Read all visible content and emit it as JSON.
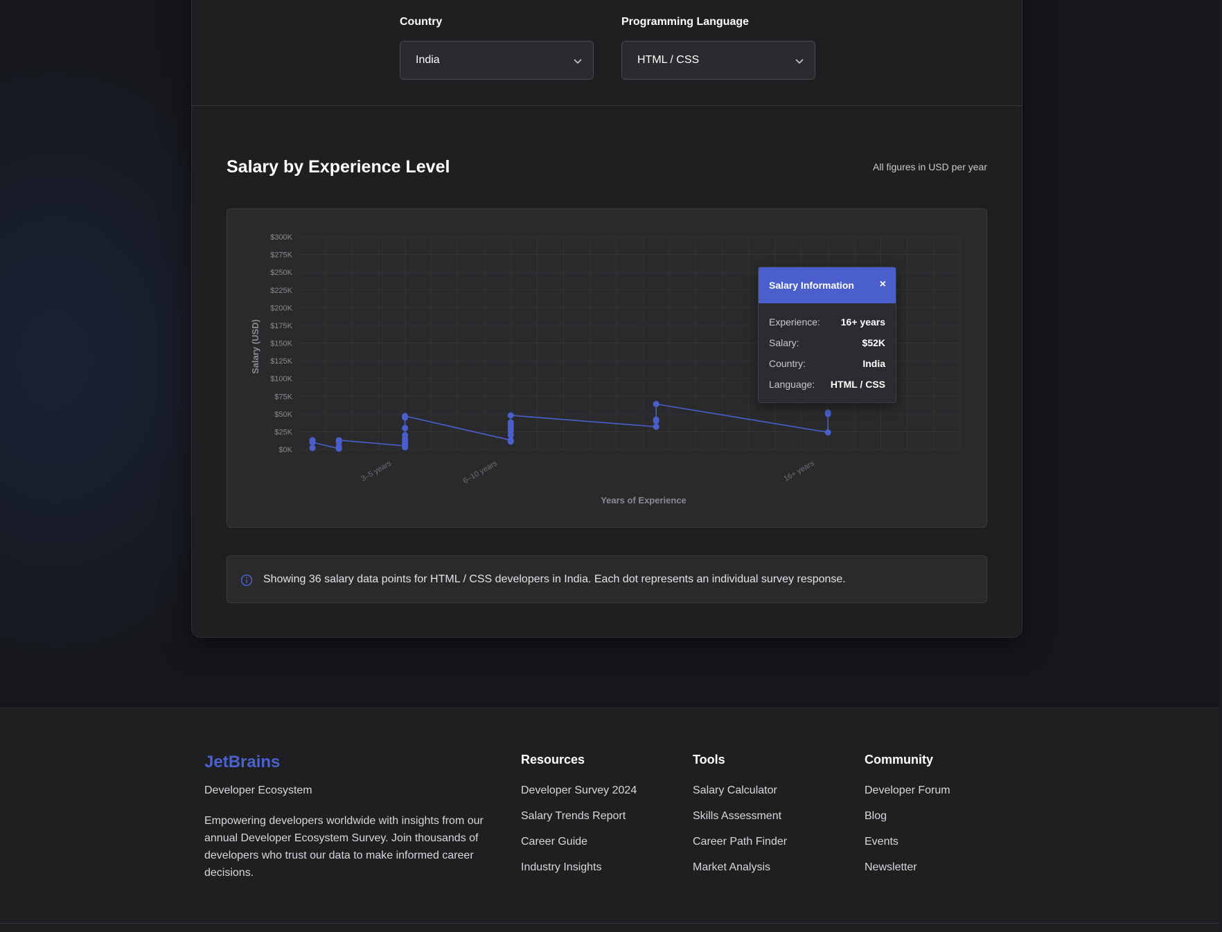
{
  "filters": {
    "country": {
      "label": "Country",
      "value": "India"
    },
    "language": {
      "label": "Programming Language",
      "value": "HTML / CSS"
    }
  },
  "section": {
    "title": "Salary by Experience Level",
    "note": "All figures in USD per year"
  },
  "chart_data": {
    "type": "scatter",
    "xlabel": "Years of Experience",
    "ylabel": "Salary (USD)",
    "x_categories_slots": 25,
    "x_tick_labels": [
      {
        "slot": 3.5,
        "label": "3–5 years"
      },
      {
        "slot": 7.5,
        "label": "6–10 years"
      },
      {
        "slot": 19.5,
        "label": "16+ years"
      }
    ],
    "y_ticks": [
      "$0K",
      "$25K",
      "$50K",
      "$75K",
      "$100K",
      "$125K",
      "$150K",
      "$175K",
      "$200K",
      "$225K",
      "$250K",
      "$275K",
      "$300K"
    ],
    "ylim": [
      0,
      300
    ],
    "grid": true,
    "accent": "#4a5fcc",
    "points": [
      {
        "slot": 0.5,
        "salary_k": 13
      },
      {
        "slot": 0.5,
        "salary_k": 10
      },
      {
        "slot": 0.5,
        "salary_k": 2
      },
      {
        "slot": 1.5,
        "salary_k": 13
      },
      {
        "slot": 1.5,
        "salary_k": 10
      },
      {
        "slot": 1.5,
        "salary_k": 4
      },
      {
        "slot": 1.5,
        "salary_k": 1
      },
      {
        "slot": 4.0,
        "salary_k": 47
      },
      {
        "slot": 4.0,
        "salary_k": 45
      },
      {
        "slot": 4.0,
        "salary_k": 30
      },
      {
        "slot": 4.0,
        "salary_k": 20
      },
      {
        "slot": 4.0,
        "salary_k": 15
      },
      {
        "slot": 4.0,
        "salary_k": 11
      },
      {
        "slot": 4.0,
        "salary_k": 8
      },
      {
        "slot": 4.0,
        "salary_k": 5
      },
      {
        "slot": 4.0,
        "salary_k": 3
      },
      {
        "slot": 8.0,
        "salary_k": 48
      },
      {
        "slot": 8.0,
        "salary_k": 38
      },
      {
        "slot": 8.0,
        "salary_k": 33
      },
      {
        "slot": 8.0,
        "salary_k": 29
      },
      {
        "slot": 8.0,
        "salary_k": 25
      },
      {
        "slot": 8.0,
        "salary_k": 20
      },
      {
        "slot": 8.0,
        "salary_k": 13
      },
      {
        "slot": 8.0,
        "salary_k": 11
      },
      {
        "slot": 13.5,
        "salary_k": 64
      },
      {
        "slot": 13.5,
        "salary_k": 42
      },
      {
        "slot": 13.5,
        "salary_k": 40
      },
      {
        "slot": 13.5,
        "salary_k": 32
      },
      {
        "slot": 20.0,
        "salary_k": 52
      },
      {
        "slot": 20.0,
        "salary_k": 50
      },
      {
        "slot": 20.0,
        "salary_k": 24
      }
    ],
    "line": [
      {
        "slot": 0.5,
        "salary_k": 13
      },
      {
        "slot": 0.5,
        "salary_k": 10
      },
      {
        "slot": 1.5,
        "salary_k": 1
      },
      {
        "slot": 1.5,
        "salary_k": 13
      },
      {
        "slot": 4.0,
        "salary_k": 5
      },
      {
        "slot": 4.0,
        "salary_k": 47
      },
      {
        "slot": 8.0,
        "salary_k": 13
      },
      {
        "slot": 8.0,
        "salary_k": 48
      },
      {
        "slot": 13.5,
        "salary_k": 32
      },
      {
        "slot": 13.5,
        "salary_k": 42
      },
      {
        "slot": 13.5,
        "salary_k": 64
      },
      {
        "slot": 20.0,
        "salary_k": 24
      },
      {
        "slot": 20.0,
        "salary_k": 52
      }
    ]
  },
  "tooltip": {
    "title": "Salary Information",
    "close": "×",
    "rows": [
      {
        "label": "Experience:",
        "value": "16+ years"
      },
      {
        "label": "Salary:",
        "value": "$52K"
      },
      {
        "label": "Country:",
        "value": "India"
      },
      {
        "label": "Language:",
        "value": "HTML / CSS"
      }
    ]
  },
  "info": {
    "icon": "info-circle-icon",
    "text": "Showing 36 salary data points for HTML / CSS developers in India. Each dot represents an individual survey response."
  },
  "footer": {
    "brand": "JetBrains",
    "brand_sub": "Developer Ecosystem",
    "description": "Empowering developers worldwide with insights from our annual Developer Ecosystem Survey. Join thousands of developers who trust our data to make informed career decisions.",
    "columns": [
      {
        "title": "Resources",
        "links": [
          "Developer Survey 2024",
          "Salary Trends Report",
          "Career Guide",
          "Industry Insights"
        ]
      },
      {
        "title": "Tools",
        "links": [
          "Salary Calculator",
          "Skills Assessment",
          "Career Path Finder",
          "Market Analysis"
        ]
      },
      {
        "title": "Community",
        "links": [
          "Developer Forum",
          "Blog",
          "Events",
          "Newsletter"
        ]
      }
    ]
  }
}
